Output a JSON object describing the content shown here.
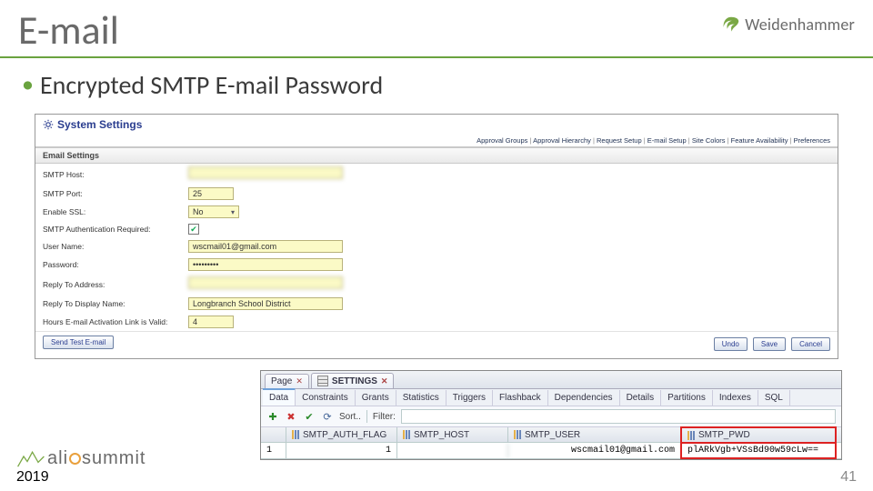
{
  "slide": {
    "title": "E-mail",
    "bullet": "Encrypted SMTP E-mail Password",
    "page_number": "41"
  },
  "brand": {
    "name": "Weidenhammer"
  },
  "summit": {
    "word_prefix": "ali",
    "word_suffix": "summit",
    "year": "2019"
  },
  "syspanel": {
    "title": "System Settings",
    "nav": [
      "Approval Groups",
      "Approval Hierarchy",
      "Request Setup",
      "E-mail Setup",
      "Site Colors",
      "Feature Availability",
      "Preferences"
    ],
    "section": "Email Settings",
    "rows": {
      "smtp_host": {
        "label": "SMTP Host:",
        "value": ""
      },
      "smtp_port": {
        "label": "SMTP Port:",
        "value": "25"
      },
      "enable_ssl": {
        "label": "Enable SSL:",
        "value": "No"
      },
      "auth_req": {
        "label": "SMTP Authentication Required:"
      },
      "user_name": {
        "label": "User Name:",
        "value": "wscmail01@gmail.com"
      },
      "password": {
        "label": "Password:",
        "value": "•••••••••"
      },
      "reply_addr": {
        "label": "Reply To Address:",
        "value": ""
      },
      "reply_name": {
        "label": "Reply To Display Name:",
        "value": "Longbranch School District"
      },
      "hours_valid": {
        "label": "Hours E-mail Activation Link is Valid:",
        "value": "4"
      }
    },
    "buttons": {
      "test": "Send Test E-mail",
      "undo": "Undo",
      "save": "Save",
      "cancel": "Cancel"
    }
  },
  "db": {
    "tabs": {
      "page": "Page",
      "settings": "SETTINGS"
    },
    "subtabs": [
      "Data",
      "Constraints",
      "Grants",
      "Statistics",
      "Triggers",
      "Flashback",
      "Dependencies",
      "Details",
      "Partitions",
      "Indexes",
      "SQL"
    ],
    "toolbar": {
      "sort": "Sort..",
      "filter": "Filter:"
    },
    "columns": [
      "SMTP_AUTH_FLAG",
      "SMTP_HOST",
      "SMTP_USER",
      "SMTP_PWD"
    ],
    "row": {
      "marker": "1",
      "flag": "1",
      "host": "",
      "user": "wscmail01@gmail.com",
      "pwd": "plARkVgb+VSsBd90w59cLw=="
    }
  }
}
